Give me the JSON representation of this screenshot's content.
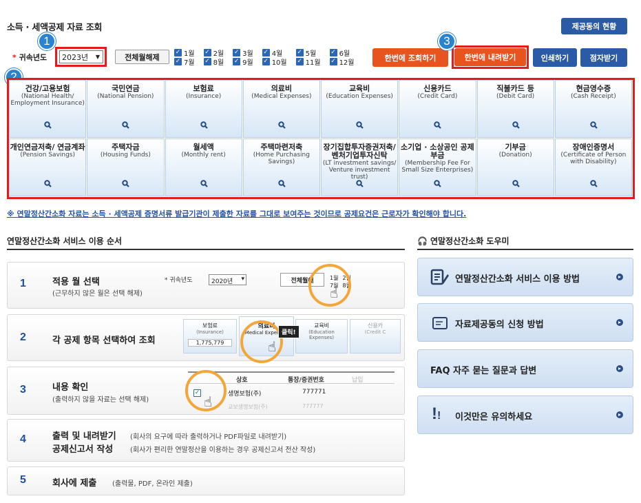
{
  "header": {
    "title": "소득 · 세액공제 자료 조회",
    "provider_status_button": "제공동의 현황"
  },
  "filter": {
    "year_label": "* 귀속년도",
    "year_value": "2023년",
    "toggle_all_button": "전체월해제",
    "months": [
      {
        "label": "1월",
        "checked": true
      },
      {
        "label": "7월",
        "checked": true
      },
      {
        "label": "2월",
        "checked": true
      },
      {
        "label": "8월",
        "checked": true
      },
      {
        "label": "3월",
        "checked": true
      },
      {
        "label": "9월",
        "checked": true
      },
      {
        "label": "4월",
        "checked": true
      },
      {
        "label": "10월",
        "checked": true
      },
      {
        "label": "5월",
        "checked": true
      },
      {
        "label": "11월",
        "checked": true
      },
      {
        "label": "6월",
        "checked": true
      },
      {
        "label": "12월",
        "checked": true
      }
    ],
    "search_all_button": "한번에 조회하기",
    "download_all_button": "한번에 내려받기",
    "print_button": "인쇄하기",
    "braille_button": "점자받기"
  },
  "badges": [
    "1",
    "2",
    "3"
  ],
  "categories": [
    {
      "ko": "건강/고용보험",
      "en": "(National Health/ Employment Insurance)"
    },
    {
      "ko": "국민연금",
      "en": "(National Pension)"
    },
    {
      "ko": "보험료",
      "en": "(Insurance)"
    },
    {
      "ko": "의료비",
      "en": "(Medical Expenses)"
    },
    {
      "ko": "교육비",
      "en": "(Education Expenses)"
    },
    {
      "ko": "신용카드",
      "en": "(Credit Card)"
    },
    {
      "ko": "직불카드 등",
      "en": "(Debit Card)"
    },
    {
      "ko": "현금영수증",
      "en": "(Cash Receipt)"
    },
    {
      "ko": "개인연금저축/ 연금계좌",
      "en": "(Pension Savings)"
    },
    {
      "ko": "주택자금",
      "en": "(Housing Funds)"
    },
    {
      "ko": "월세액",
      "en": "(Monthly rent)"
    },
    {
      "ko": "주택마련저축",
      "en": "(Home Purchasing Savings)"
    },
    {
      "ko": "장기집합투자증권저축/ 벤처기업투자신탁",
      "en": "(LT investment savings/ Venture investment trust)"
    },
    {
      "ko": "소기업 · 소상공인 공제부금",
      "en": "(Membership Fee For Small Size Enterprises)"
    },
    {
      "ko": "기부금",
      "en": "(Donation)"
    },
    {
      "ko": "장애인증명서",
      "en": "(Certificate of Person with Disability)"
    }
  ],
  "notice": "※ 연말정산간소화 자료는 소득 · 세액공제 증명서류 발급기관이 제출한 자료를 그대로 보여주는 것이므로 공제요건은 근로자가 확인해야 합니다.",
  "steps_section": {
    "title": "연말정산간소화 서비스 이용 순서",
    "steps": [
      {
        "num": "1",
        "title": "적용 월 선택",
        "sub": "(근무하지 않은 월은 선택 해제)"
      },
      {
        "num": "2",
        "title": "각 공제 항목 선택하여 조회",
        "sub": ""
      },
      {
        "num": "3",
        "title": "내용 확인",
        "sub": "(출력하지 않을 자료는 선택 해제)"
      },
      {
        "num": "4",
        "title": "출력 및 내려받기",
        "title2": "공제신고서 작성",
        "sub": "(회사의 요구에 따라 출력하거나 PDF파일로 내려받기)",
        "sub2": "(회사가 편리한 연말정산을 이용하는 경우 공제신고서 전산 작성)"
      },
      {
        "num": "5",
        "title": "회사에 제출",
        "sub": "(출력물, PDF, 온라인 제출)"
      }
    ]
  },
  "illustrations": {
    "step1": {
      "year_label": "* 귀속년도",
      "year_value": "2020년",
      "toggle": "전체월해",
      "m1": "1월",
      "m7": "7월",
      "m2": "2월",
      "m8": "8월"
    },
    "step2": {
      "c1_ko": "보험료",
      "c1_en": "(Insurance)",
      "c1_value": "1,775,779",
      "c2_ko": "의료비",
      "c2_en": "(Medical Expenses)",
      "c3_ko": "교육비",
      "c3_en": "(Education Expenses)",
      "c4_ko": "신용카",
      "c4_en": "(Credit C",
      "click": "클릭!"
    },
    "step3": {
      "col1": "상호",
      "col2": "통장/증권번호",
      "col3": "납입",
      "row_name": "생명보험(주)",
      "row_num": "777771",
      "row2_name": "교보생명보험(주)",
      "row2_num": "777777"
    }
  },
  "helper_section": {
    "title": "연말정산간소화 도우미",
    "items": [
      {
        "label": "연말정산간소화 서비스 이용 방법",
        "icon": "document-pen-icon"
      },
      {
        "label": "자료제공동의 신청 방법",
        "icon": "document-icon"
      },
      {
        "label": "FAQ 자주 묻는 질문과 답변",
        "icon": "faq-icon"
      },
      {
        "label": "이것만은 유의하세요",
        "icon": "exclamation-icon"
      }
    ]
  }
}
